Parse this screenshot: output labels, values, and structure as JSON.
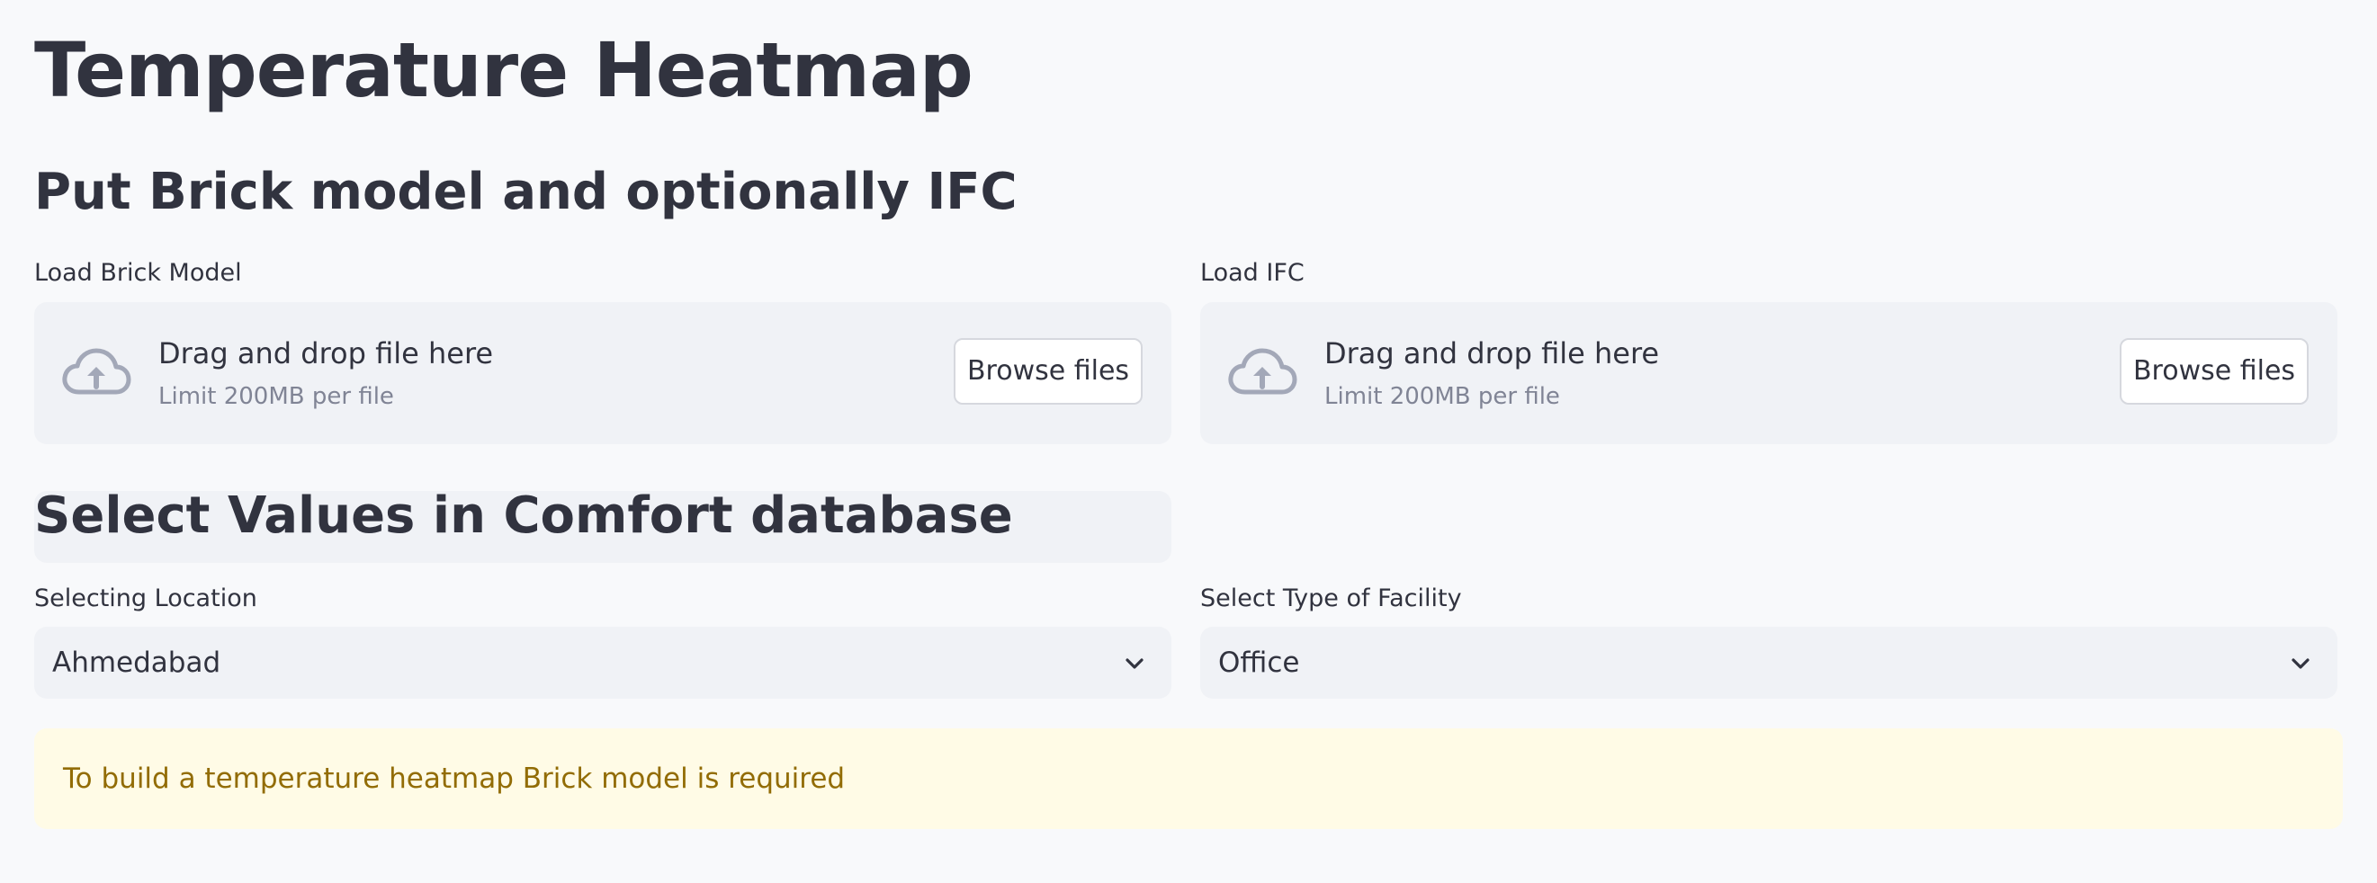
{
  "page": {
    "title": "Temperature Heatmap"
  },
  "upload_section": {
    "heading": "Put Brick model and optionally IFC",
    "brick": {
      "label": "Load Brick Model",
      "drag_text": "Drag and drop file here",
      "limit_text": "Limit 200MB per file",
      "button_label": "Browse files",
      "icon": "cloud-upload-icon"
    },
    "ifc": {
      "label": "Load IFC",
      "drag_text": "Drag and drop file here",
      "limit_text": "Limit 200MB per file",
      "button_label": "Browse files",
      "icon": "cloud-upload-icon"
    }
  },
  "select_section": {
    "heading": "Select Values in Comfort database",
    "location": {
      "label": "Selecting Location",
      "value": "Ahmedabad",
      "icon": "chevron-down-icon"
    },
    "facility": {
      "label": "Select Type of Facility",
      "value": "Office",
      "icon": "chevron-down-icon"
    }
  },
  "alert": {
    "message": "To build a temperature heatmap Brick model is required",
    "background_color": "#fffbe6",
    "text_color": "#926c05"
  },
  "colors": {
    "page_background": "#f8f9fb",
    "text": "#31333f",
    "widget_background": "#f0f2f6",
    "muted_text": "#808495",
    "icon": "#a3a8b8"
  }
}
